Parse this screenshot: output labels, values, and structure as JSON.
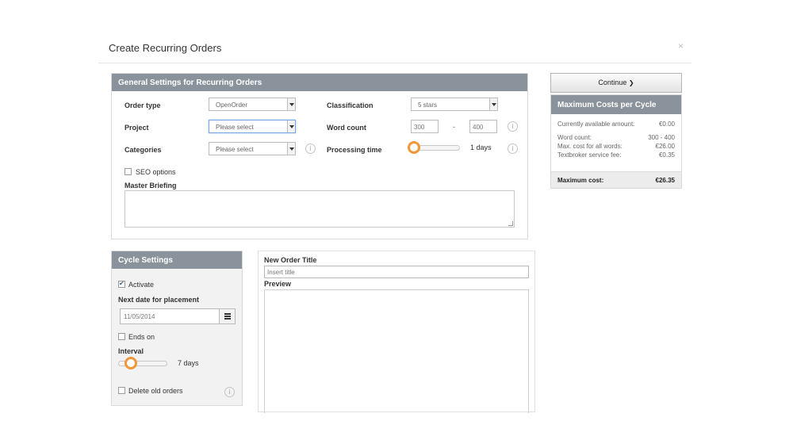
{
  "dialog": {
    "title": "Create Recurring Orders",
    "close_icon": "×"
  },
  "general": {
    "heading": "General Settings for Recurring Orders",
    "order_type_label": "Order type",
    "order_type_value": "OpenOrder",
    "project_label": "Project",
    "project_value": "Please select",
    "categories_label": "Categories",
    "categories_value": "Please select",
    "classification_label": "Classification",
    "classification_value": "5 stars",
    "word_count_label": "Word count",
    "word_count_min": "300",
    "word_count_sep": "-",
    "word_count_max": "400",
    "processing_label": "Processing time",
    "processing_value": "1 days",
    "seo_label": "SEO options",
    "briefing_label": "Master Briefing"
  },
  "cycle": {
    "heading": "Cycle Settings",
    "activate_label": "Activate",
    "next_date_label": "Next date for placement",
    "next_date_value": "11/05/2014",
    "ends_on_label": "Ends on",
    "interval_label": "Interval",
    "interval_value": "7 days",
    "delete_label": "Delete old orders"
  },
  "order": {
    "title_label": "New Order Title",
    "title_placeholder": "Insert title",
    "preview_label": "Preview"
  },
  "sidebar": {
    "continue_label": "Continue",
    "continue_icon": "❯",
    "costs_heading": "Maximum Costs per Cycle",
    "rows": [
      {
        "label": "Currently available amount:",
        "value": "€0.00"
      },
      {
        "label": "Word count:",
        "value": "300 - 400"
      },
      {
        "label": "Max. cost for all words:",
        "value": "€26.00"
      },
      {
        "label": "Textbroker service fee:",
        "value": "€0.35"
      }
    ],
    "total_label": "Maximum cost:",
    "total_value": "€26.35"
  },
  "info_icon": "i",
  "colors": {
    "panel_header": "#8a939c",
    "slider_knob": "#f0973a"
  }
}
